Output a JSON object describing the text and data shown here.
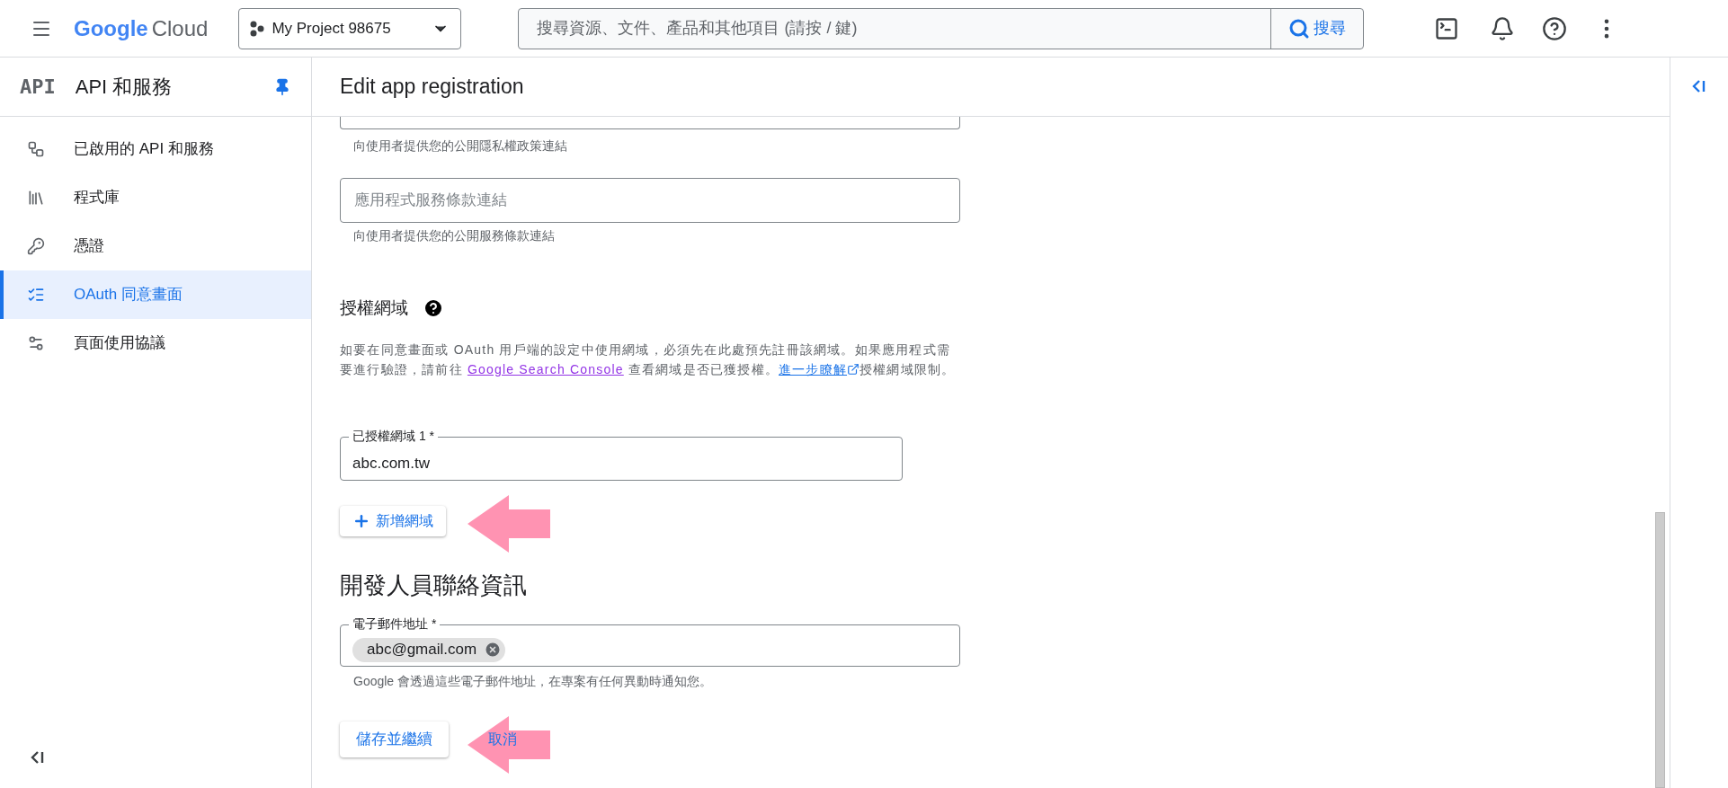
{
  "header": {
    "logo": {
      "google": "Google",
      "cloud": "Cloud"
    },
    "project": "My Project 98675",
    "search": {
      "placeholder": "搜尋資源、文件、產品和其他項目 (請按 / 鍵)",
      "button": "搜尋"
    }
  },
  "sidebar": {
    "badge": "API",
    "title": "API 和服務",
    "items": [
      {
        "label": "已啟用的 API 和服務",
        "kind": "grid",
        "selected": false
      },
      {
        "label": "程式庫",
        "kind": "library",
        "selected": false
      },
      {
        "label": "憑證",
        "kind": "key",
        "selected": false
      },
      {
        "label": "OAuth 同意畫面",
        "kind": "consent",
        "selected": true
      },
      {
        "label": "頁面使用協議",
        "kind": "settings",
        "selected": false
      }
    ]
  },
  "page": {
    "title": "Edit app registration",
    "privacy_hint": "向使用者提供您的公開隱私權政策連結",
    "terms_field": {
      "placeholder": "應用程式服務條款連結",
      "hint": "向使用者提供您的公開服務條款連結"
    },
    "domains": {
      "heading": "授權網域",
      "description": {
        "before": "如要在同意畫面或 OAuth 用戶端的設定中使用網域，必須先在此處預先註冊該網域。如果應用程式需要進行驗證，請前往 ",
        "link1": "Google Search Console",
        "middle": " 查看網域是否已獲授權。",
        "link2": "進一步瞭解",
        "after": "授權網域限制。"
      },
      "fields": [
        {
          "label": "已授權網域 1 *",
          "value": "abc.com.tw"
        }
      ],
      "add_button": "新增網域"
    },
    "contact": {
      "heading": "開發人員聯絡資訊",
      "label": "電子郵件地址 *",
      "chips": [
        "abc@gmail.com"
      ],
      "hint": "Google 會透過這些電子郵件地址，在專案有任何異動時通知您。"
    },
    "save_button": "儲存並繼續",
    "cancel_button": "取消"
  }
}
